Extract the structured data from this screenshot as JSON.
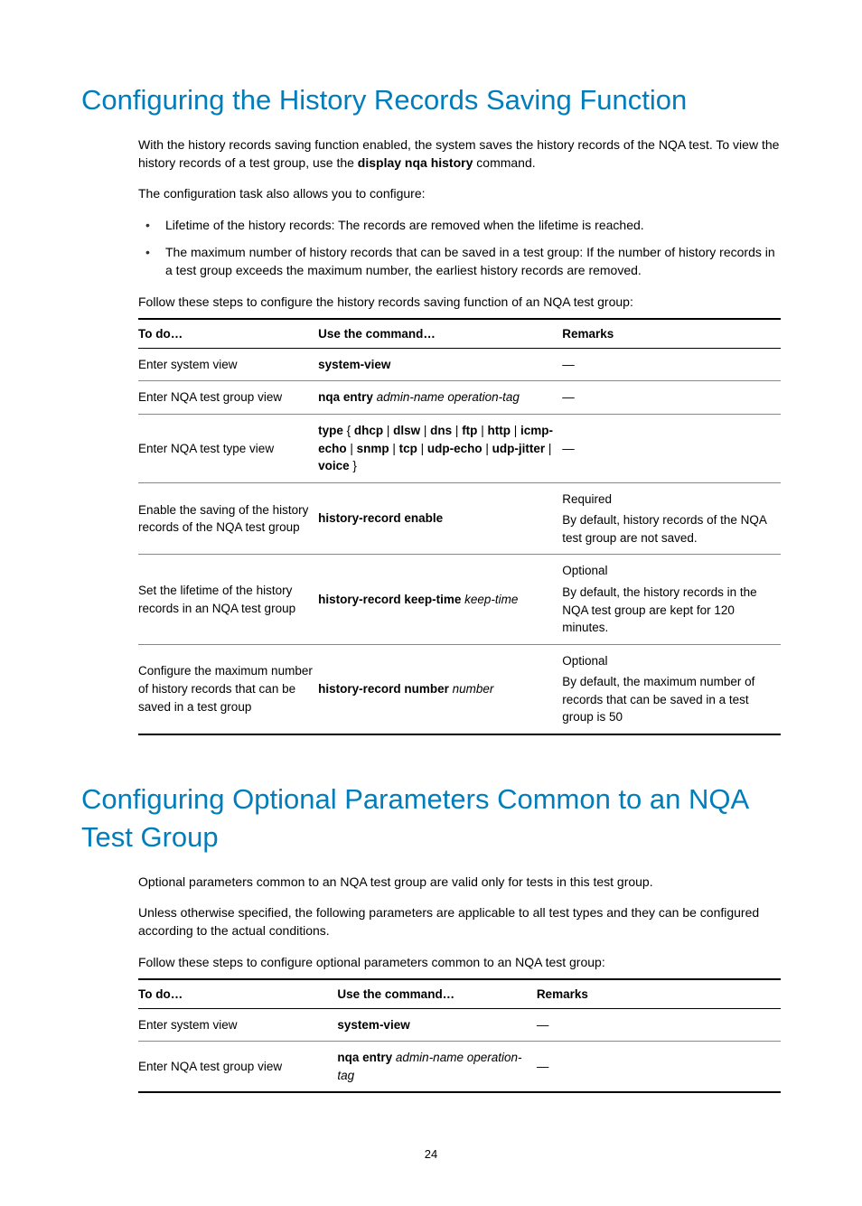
{
  "section1": {
    "heading": "Configuring the History Records Saving Function",
    "intro1a": "With the history records saving function enabled, the system saves the history records of the NQA test. To view the history records of a test group, use the ",
    "intro1b_bold": "display nqa history",
    "intro1c": " command.",
    "intro2": "The configuration task also allows you to configure:",
    "bullets": [
      "Lifetime of the history records: The records are removed when the lifetime is reached.",
      "The maximum number of history records that can be saved in a test group: If the number of history records in a test group exceeds the maximum number, the earliest history records are removed."
    ],
    "steps_intro": "Follow these steps to configure the history records saving function of an NQA test group:",
    "table_headers": {
      "todo": "To do…",
      "cmd": "Use the command…",
      "rem": "Remarks"
    },
    "rows": [
      {
        "todo": "Enter system view",
        "cmd_bold1": "system-view",
        "remarks": "—"
      },
      {
        "todo": "Enter NQA test group view",
        "cmd_bold1": "nqa entry",
        "cmd_italic1": " admin-name operation-tag",
        "remarks": "—"
      },
      {
        "todo": "Enter NQA test type view",
        "remarks": "—"
      },
      {
        "todo": "Enable the saving of the history records of the NQA test group",
        "cmd_bold1": "history-record enable",
        "rem_line1": "Required",
        "rem_line2": "By default, history records of the NQA test group are not saved."
      },
      {
        "todo": "Set the lifetime of the history records in an NQA test group",
        "cmd_bold1": "history-record keep-time",
        "cmd_italic1": " keep-time",
        "rem_line1": "Optional",
        "rem_line2": "By default, the history records in the NQA test group are kept for 120 minutes."
      },
      {
        "todo": "Configure the maximum number of history records that can be saved in a test group",
        "cmd_bold1": "history-record number",
        "cmd_italic1": " number",
        "rem_line1": "Optional",
        "rem_line2": "By default, the maximum number of records that can be saved in a test group is 50"
      }
    ],
    "type_cmd": {
      "p1": "type",
      "p2": " { ",
      "p3": "dhcp",
      "p4": " | ",
      "p5": "dlsw",
      "p6": " | ",
      "p7": "dns",
      "p8": " | ",
      "p9": "ftp",
      "p10": " | ",
      "p11": "http",
      "p12": " | ",
      "p13": "icmp-echo",
      "p14": " | ",
      "p15": "snmp",
      "p16": " | ",
      "p17": "tcp",
      "p18": " | ",
      "p19": "udp-echo",
      "p20": " | ",
      "p21": "udp-jitter",
      "p22": " | ",
      "p23": "voice",
      "p24": " }"
    }
  },
  "section2": {
    "heading": "Configuring Optional Parameters Common to an NQA Test Group",
    "intro1": "Optional parameters common to an NQA test group are valid only for tests in this test group.",
    "intro2": "Unless otherwise specified, the following parameters are applicable to all test types and they can be configured according to the actual conditions.",
    "steps_intro": "Follow these steps to configure optional parameters common to an NQA test group:",
    "table_headers": {
      "todo": "To do…",
      "cmd": "Use the command…",
      "rem": "Remarks"
    },
    "rows": [
      {
        "todo": "Enter system view",
        "cmd_bold1": "system-view",
        "remarks": "—"
      },
      {
        "todo": "Enter NQA test group view",
        "cmd_bold1": "nqa entry",
        "cmd_italic1": " admin-name operation-tag",
        "remarks": "—"
      }
    ]
  },
  "page_number": "24"
}
